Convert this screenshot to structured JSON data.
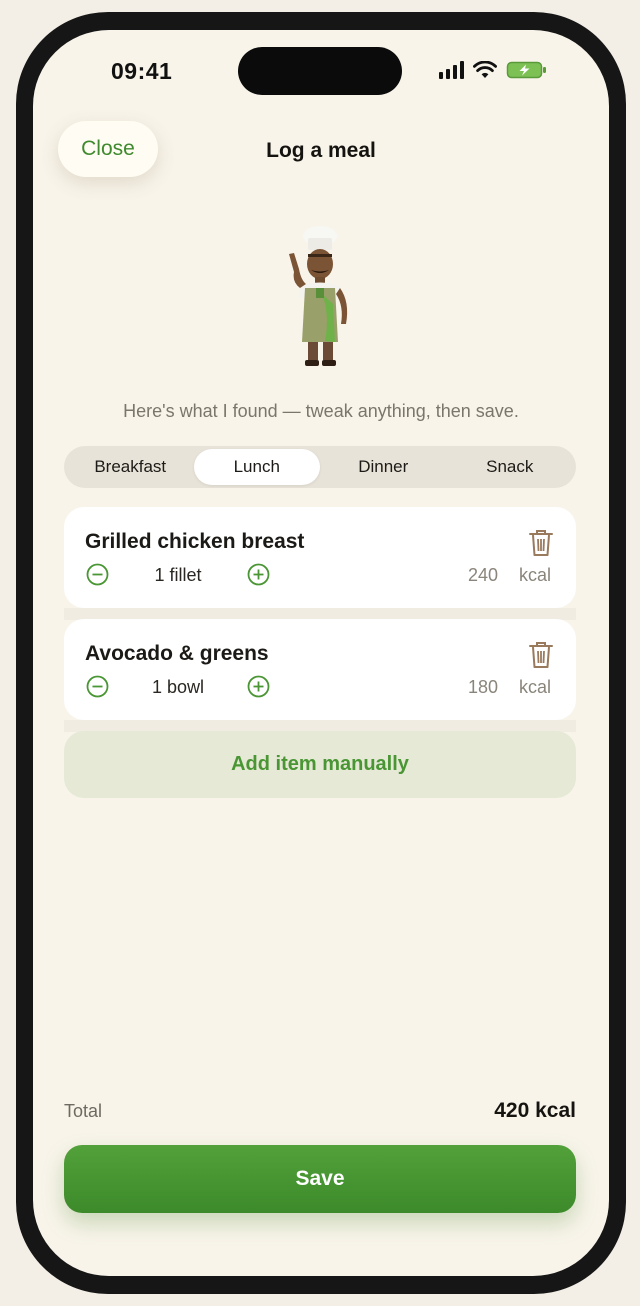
{
  "status_bar": {
    "time": "09:41"
  },
  "nav": {
    "close_label": "Close",
    "title": "Log a meal"
  },
  "assistant": {
    "message": "Here's what I found — tweak anything, then save."
  },
  "meal_tabs": {
    "selected": "Lunch",
    "options": [
      "Breakfast",
      "Lunch",
      "Dinner",
      "Snack"
    ]
  },
  "items": [
    {
      "name": "Grilled chicken breast",
      "quantity": "1 fillet",
      "calories": "240",
      "unit": "kcal"
    },
    {
      "name": "Avocado & greens",
      "quantity": "1 bowl",
      "calories": "180",
      "unit": "kcal"
    }
  ],
  "add_manual_label": "Add item manually",
  "summary": {
    "total_label": "Total",
    "total_value": "420 kcal"
  },
  "save_label": "Save",
  "colors": {
    "accent": "#4a9634",
    "background": "#f8f4ea",
    "card": "#ffffff",
    "trash": "#9a7a5c"
  }
}
